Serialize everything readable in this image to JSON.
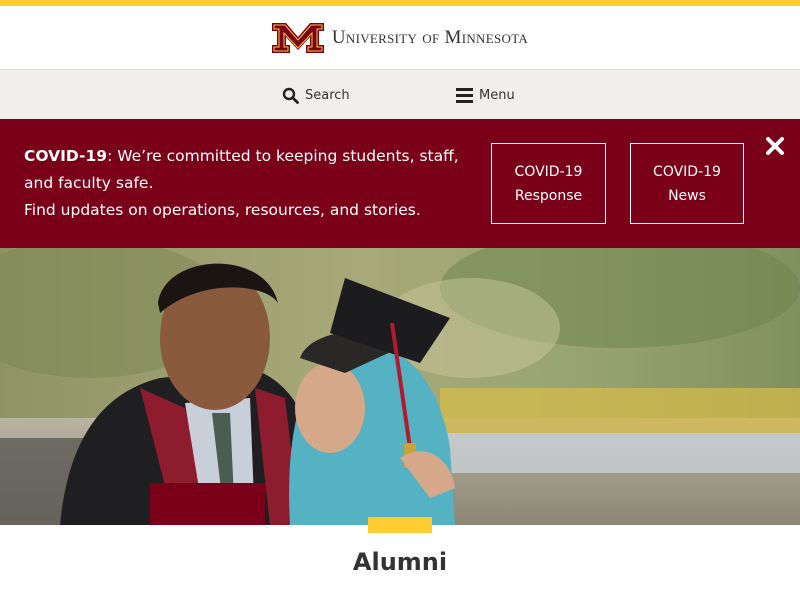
{
  "brand": {
    "wordmark": "University of Minnesota",
    "maroon": "#7a0019",
    "gold": "#ffcc33"
  },
  "nav": {
    "search_label": "Search",
    "menu_label": "Menu",
    "search_icon": "search-icon",
    "menu_icon": "hamburger-icon"
  },
  "alert": {
    "bold_label": "COVID-19",
    "line1": ": We’re committed to keeping students, staff, and faculty safe.",
    "line2": "Find updates on operations, resources, and stories.",
    "btn_response_line1": "COVID-19",
    "btn_response_line2": "Response",
    "btn_news_line1": "COVID-19",
    "btn_news_line2": "News",
    "close_icon": "close-icon"
  },
  "page": {
    "title": "Alumni"
  }
}
